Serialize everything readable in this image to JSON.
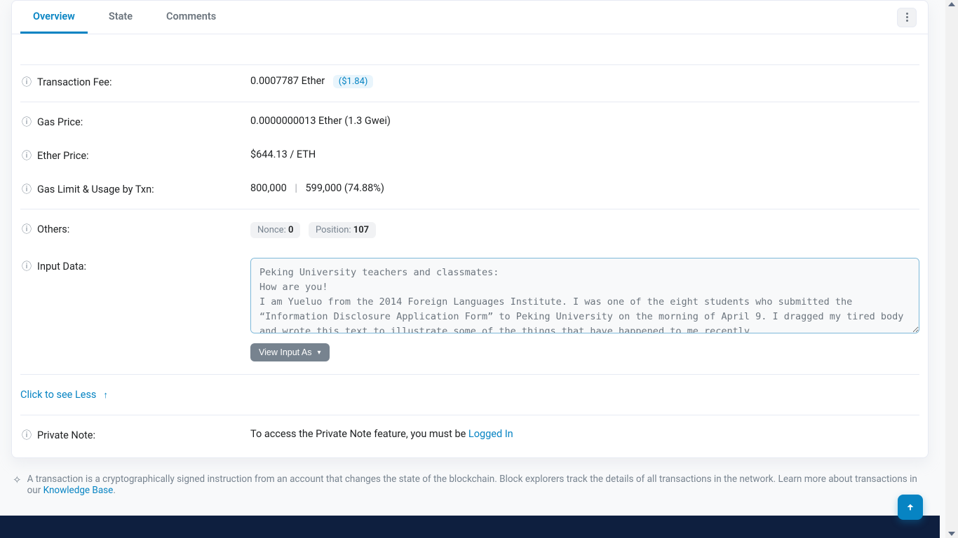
{
  "tabs": {
    "overview": "Overview",
    "state": "State",
    "comments": "Comments"
  },
  "fields": {
    "transaction_fee": {
      "label": "Transaction Fee:",
      "value": "0.0007787 Ether",
      "usd": "($1.84)"
    },
    "gas_price": {
      "label": "Gas Price:",
      "value": "0.0000000013 Ether (1.3 Gwei)"
    },
    "ether_price": {
      "label": "Ether Price:",
      "value": "$644.13 / ETH"
    },
    "gas_limit_usage": {
      "label": "Gas Limit & Usage by Txn:",
      "limit": "800,000",
      "used": "599,000 (74.88%)"
    },
    "others": {
      "label": "Others:",
      "nonce_label": "Nonce:",
      "nonce_value": "0",
      "position_label": "Position:",
      "position_value": "107"
    },
    "input_data": {
      "label": "Input Data:",
      "text": "Peking University teachers and classmates:\nHow are you!\nI am Yueluo from the 2014 Foreign Languages Institute. I was one of the eight students who submitted the “Information Disclosure Application Form” to Peking University on the morning of April 9. I dragged my tired body and wrote this text to illustrate some of the things that have happened to me recently.",
      "view_button": "View Input As"
    },
    "see_less": "Click to see Less",
    "private_note": {
      "label": "Private Note:",
      "prefix": "To access the Private Note feature, you must be ",
      "link": "Logged In"
    }
  },
  "footer_note": {
    "text": "A transaction is a cryptographically signed instruction from an account that changes the state of the blockchain. Block explorers track the details of all transactions in the network. Learn more about transactions in our ",
    "link": "Knowledge Base",
    "suffix": "."
  }
}
